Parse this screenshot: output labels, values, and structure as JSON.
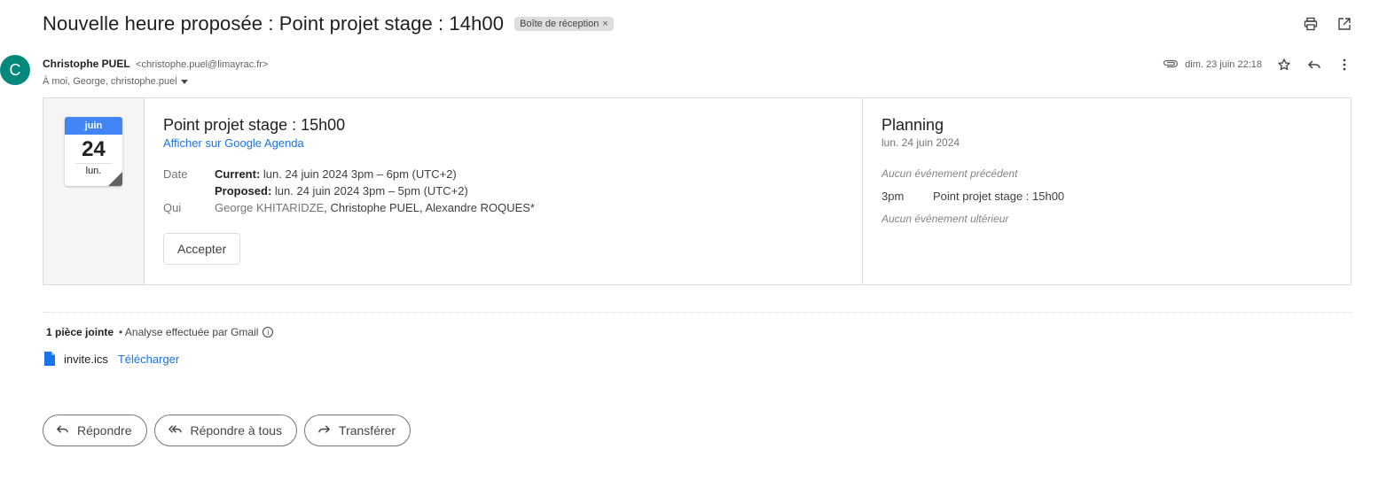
{
  "email": {
    "subject": "Nouvelle heure proposée : Point projet stage : 14h00",
    "label": "Boîte de réception",
    "label_close": "×",
    "sender_initial": "C",
    "sender_name": "Christophe PUEL",
    "sender_email": "<christophe.puel@limayrac.fr>",
    "recipients": "À moi, George, christophe.puel",
    "date": "dim. 23 juin 22:18"
  },
  "icons": {
    "print": "printer-icon",
    "popout": "open-in-new-icon",
    "attachment": "paperclip-icon",
    "star": "star-icon",
    "reply": "reply-icon",
    "more": "more-vert-icon"
  },
  "invite": {
    "cal_month": "juin",
    "cal_day": "24",
    "cal_dow": "lun.",
    "title": "Point projet stage : 15h00",
    "gcal_link": "Afficher sur Google Agenda",
    "date_label": "Date",
    "current_label": "Current:",
    "current_value": " lun. 24 juin 2024 3pm – 6pm (UTC+2)",
    "proposed_label": "Proposed:",
    "proposed_value": " lun. 24 juin 2024 3pm – 5pm (UTC+2)",
    "who_label": "Qui",
    "guest_1": "George KHITARIDZE",
    "guest_rest": ", Christophe PUEL, Alexandre ROQUES*",
    "accept_label": "Accepter"
  },
  "planning": {
    "title": "Planning",
    "date": "lun. 24 juin 2024",
    "before": "Aucun événement précédent",
    "event_time": "3pm",
    "event_title": "Point projet stage : 15h00",
    "after": "Aucun événement ultérieur"
  },
  "attachments": {
    "count_label": "1 pièce jointe",
    "scan_label": "• Analyse effectuée par Gmail",
    "info_glyph": "i",
    "file_name": "invite.ics",
    "download_label": "Télécharger"
  },
  "actions": {
    "reply": "Répondre",
    "reply_all": "Répondre à tous",
    "forward": "Transférer"
  },
  "colors": {
    "avatar": "#00897b",
    "link": "#1a73e8",
    "calendar_header": "#4285f4"
  }
}
